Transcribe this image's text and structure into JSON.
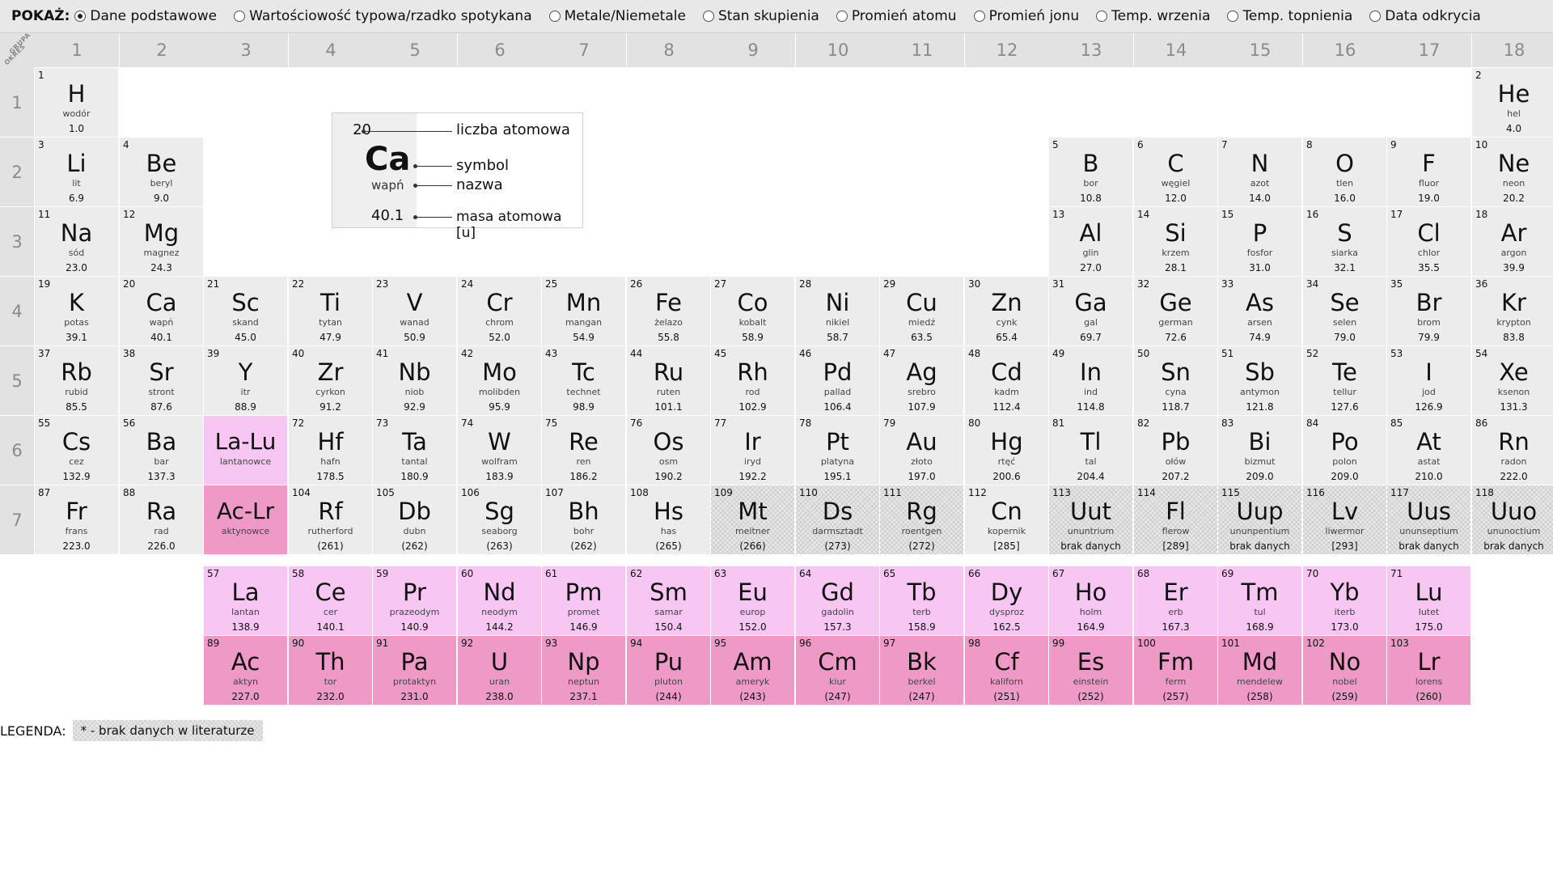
{
  "show_label": "POKAŻ:",
  "options": [
    {
      "label": "Dane podstawowe",
      "checked": true
    },
    {
      "label": "Wartościowość typowa/rzadko spotykana",
      "checked": false
    },
    {
      "label": "Metale/Niemetale",
      "checked": false
    },
    {
      "label": "Stan skupienia",
      "checked": false
    },
    {
      "label": "Promień atomu",
      "checked": false
    },
    {
      "label": "Promień jonu",
      "checked": false
    },
    {
      "label": "Temp. wrzenia",
      "checked": false
    },
    {
      "label": "Temp. topnienia",
      "checked": false
    },
    {
      "label": "Data odkrycia",
      "checked": false
    }
  ],
  "corner": {
    "grupa": "GRUPA",
    "okres": "OKRES"
  },
  "groups": [
    "1",
    "2",
    "3",
    "4",
    "5",
    "6",
    "7",
    "8",
    "9",
    "10",
    "11",
    "12",
    "13",
    "14",
    "15",
    "16",
    "17",
    "18"
  ],
  "periods": [
    "1",
    "2",
    "3",
    "4",
    "5",
    "6",
    "7"
  ],
  "key": {
    "num": "20",
    "sym": "Ca",
    "name": "wapń",
    "mass": "40.1",
    "lbl_num": "liczba atomowa",
    "lbl_sym": "symbol",
    "lbl_name": "nazwa",
    "lbl_mass": "masa atomowa [u]"
  },
  "elements": [
    {
      "n": "1",
      "s": "H",
      "name": "wodór",
      "m": "1.0",
      "p": 1,
      "g": 1
    },
    {
      "n": "2",
      "s": "He",
      "name": "hel",
      "m": "4.0",
      "p": 1,
      "g": 18
    },
    {
      "n": "3",
      "s": "Li",
      "name": "lit",
      "m": "6.9",
      "p": 2,
      "g": 1
    },
    {
      "n": "4",
      "s": "Be",
      "name": "beryl",
      "m": "9.0",
      "p": 2,
      "g": 2
    },
    {
      "n": "5",
      "s": "B",
      "name": "bor",
      "m": "10.8",
      "p": 2,
      "g": 13
    },
    {
      "n": "6",
      "s": "C",
      "name": "węgiel",
      "m": "12.0",
      "p": 2,
      "g": 14
    },
    {
      "n": "7",
      "s": "N",
      "name": "azot",
      "m": "14.0",
      "p": 2,
      "g": 15
    },
    {
      "n": "8",
      "s": "O",
      "name": "tlen",
      "m": "16.0",
      "p": 2,
      "g": 16
    },
    {
      "n": "9",
      "s": "F",
      "name": "fluor",
      "m": "19.0",
      "p": 2,
      "g": 17
    },
    {
      "n": "10",
      "s": "Ne",
      "name": "neon",
      "m": "20.2",
      "p": 2,
      "g": 18
    },
    {
      "n": "11",
      "s": "Na",
      "name": "sód",
      "m": "23.0",
      "p": 3,
      "g": 1
    },
    {
      "n": "12",
      "s": "Mg",
      "name": "magnez",
      "m": "24.3",
      "p": 3,
      "g": 2
    },
    {
      "n": "13",
      "s": "Al",
      "name": "glin",
      "m": "27.0",
      "p": 3,
      "g": 13
    },
    {
      "n": "14",
      "s": "Si",
      "name": "krzem",
      "m": "28.1",
      "p": 3,
      "g": 14
    },
    {
      "n": "15",
      "s": "P",
      "name": "fosfor",
      "m": "31.0",
      "p": 3,
      "g": 15
    },
    {
      "n": "16",
      "s": "S",
      "name": "siarka",
      "m": "32.1",
      "p": 3,
      "g": 16
    },
    {
      "n": "17",
      "s": "Cl",
      "name": "chlor",
      "m": "35.5",
      "p": 3,
      "g": 17
    },
    {
      "n": "18",
      "s": "Ar",
      "name": "argon",
      "m": "39.9",
      "p": 3,
      "g": 18
    },
    {
      "n": "19",
      "s": "K",
      "name": "potas",
      "m": "39.1",
      "p": 4,
      "g": 1
    },
    {
      "n": "20",
      "s": "Ca",
      "name": "wapń",
      "m": "40.1",
      "p": 4,
      "g": 2
    },
    {
      "n": "21",
      "s": "Sc",
      "name": "skand",
      "m": "45.0",
      "p": 4,
      "g": 3
    },
    {
      "n": "22",
      "s": "Ti",
      "name": "tytan",
      "m": "47.9",
      "p": 4,
      "g": 4
    },
    {
      "n": "23",
      "s": "V",
      "name": "wanad",
      "m": "50.9",
      "p": 4,
      "g": 5
    },
    {
      "n": "24",
      "s": "Cr",
      "name": "chrom",
      "m": "52.0",
      "p": 4,
      "g": 6
    },
    {
      "n": "25",
      "s": "Mn",
      "name": "mangan",
      "m": "54.9",
      "p": 4,
      "g": 7
    },
    {
      "n": "26",
      "s": "Fe",
      "name": "żelazo",
      "m": "55.8",
      "p": 4,
      "g": 8
    },
    {
      "n": "27",
      "s": "Co",
      "name": "kobalt",
      "m": "58.9",
      "p": 4,
      "g": 9
    },
    {
      "n": "28",
      "s": "Ni",
      "name": "nikiel",
      "m": "58.7",
      "p": 4,
      "g": 10
    },
    {
      "n": "29",
      "s": "Cu",
      "name": "miedź",
      "m": "63.5",
      "p": 4,
      "g": 11
    },
    {
      "n": "30",
      "s": "Zn",
      "name": "cynk",
      "m": "65.4",
      "p": 4,
      "g": 12
    },
    {
      "n": "31",
      "s": "Ga",
      "name": "gal",
      "m": "69.7",
      "p": 4,
      "g": 13
    },
    {
      "n": "32",
      "s": "Ge",
      "name": "german",
      "m": "72.6",
      "p": 4,
      "g": 14
    },
    {
      "n": "33",
      "s": "As",
      "name": "arsen",
      "m": "74.9",
      "p": 4,
      "g": 15
    },
    {
      "n": "34",
      "s": "Se",
      "name": "selen",
      "m": "79.0",
      "p": 4,
      "g": 16
    },
    {
      "n": "35",
      "s": "Br",
      "name": "brom",
      "m": "79.9",
      "p": 4,
      "g": 17
    },
    {
      "n": "36",
      "s": "Kr",
      "name": "krypton",
      "m": "83.8",
      "p": 4,
      "g": 18
    },
    {
      "n": "37",
      "s": "Rb",
      "name": "rubid",
      "m": "85.5",
      "p": 5,
      "g": 1
    },
    {
      "n": "38",
      "s": "Sr",
      "name": "stront",
      "m": "87.6",
      "p": 5,
      "g": 2
    },
    {
      "n": "39",
      "s": "Y",
      "name": "itr",
      "m": "88.9",
      "p": 5,
      "g": 3
    },
    {
      "n": "40",
      "s": "Zr",
      "name": "cyrkon",
      "m": "91.2",
      "p": 5,
      "g": 4
    },
    {
      "n": "41",
      "s": "Nb",
      "name": "niob",
      "m": "92.9",
      "p": 5,
      "g": 5
    },
    {
      "n": "42",
      "s": "Mo",
      "name": "molibden",
      "m": "95.9",
      "p": 5,
      "g": 6
    },
    {
      "n": "43",
      "s": "Tc",
      "name": "technet",
      "m": "98.9",
      "p": 5,
      "g": 7
    },
    {
      "n": "44",
      "s": "Ru",
      "name": "ruten",
      "m": "101.1",
      "p": 5,
      "g": 8
    },
    {
      "n": "45",
      "s": "Rh",
      "name": "rod",
      "m": "102.9",
      "p": 5,
      "g": 9
    },
    {
      "n": "46",
      "s": "Pd",
      "name": "pallad",
      "m": "106.4",
      "p": 5,
      "g": 10
    },
    {
      "n": "47",
      "s": "Ag",
      "name": "srebro",
      "m": "107.9",
      "p": 5,
      "g": 11
    },
    {
      "n": "48",
      "s": "Cd",
      "name": "kadm",
      "m": "112.4",
      "p": 5,
      "g": 12
    },
    {
      "n": "49",
      "s": "In",
      "name": "ind",
      "m": "114.8",
      "p": 5,
      "g": 13
    },
    {
      "n": "50",
      "s": "Sn",
      "name": "cyna",
      "m": "118.7",
      "p": 5,
      "g": 14
    },
    {
      "n": "51",
      "s": "Sb",
      "name": "antymon",
      "m": "121.8",
      "p": 5,
      "g": 15
    },
    {
      "n": "52",
      "s": "Te",
      "name": "tellur",
      "m": "127.6",
      "p": 5,
      "g": 16
    },
    {
      "n": "53",
      "s": "I",
      "name": "jod",
      "m": "126.9",
      "p": 5,
      "g": 17
    },
    {
      "n": "54",
      "s": "Xe",
      "name": "ksenon",
      "m": "131.3",
      "p": 5,
      "g": 18
    },
    {
      "n": "55",
      "s": "Cs",
      "name": "cez",
      "m": "132.9",
      "p": 6,
      "g": 1
    },
    {
      "n": "56",
      "s": "Ba",
      "name": "bar",
      "m": "137.3",
      "p": 6,
      "g": 2
    },
    {
      "n": "",
      "s": "La-Lu",
      "name": "lantanowce",
      "m": "",
      "p": 6,
      "g": 3,
      "cls": "la-placeholder placeholder"
    },
    {
      "n": "72",
      "s": "Hf",
      "name": "hafn",
      "m": "178.5",
      "p": 6,
      "g": 4
    },
    {
      "n": "73",
      "s": "Ta",
      "name": "tantal",
      "m": "180.9",
      "p": 6,
      "g": 5
    },
    {
      "n": "74",
      "s": "W",
      "name": "wolfram",
      "m": "183.9",
      "p": 6,
      "g": 6
    },
    {
      "n": "75",
      "s": "Re",
      "name": "ren",
      "m": "186.2",
      "p": 6,
      "g": 7
    },
    {
      "n": "76",
      "s": "Os",
      "name": "osm",
      "m": "190.2",
      "p": 6,
      "g": 8
    },
    {
      "n": "77",
      "s": "Ir",
      "name": "iryd",
      "m": "192.2",
      "p": 6,
      "g": 9
    },
    {
      "n": "78",
      "s": "Pt",
      "name": "platyna",
      "m": "195.1",
      "p": 6,
      "g": 10
    },
    {
      "n": "79",
      "s": "Au",
      "name": "złoto",
      "m": "197.0",
      "p": 6,
      "g": 11
    },
    {
      "n": "80",
      "s": "Hg",
      "name": "rtęć",
      "m": "200.6",
      "p": 6,
      "g": 12
    },
    {
      "n": "81",
      "s": "Tl",
      "name": "tal",
      "m": "204.4",
      "p": 6,
      "g": 13
    },
    {
      "n": "82",
      "s": "Pb",
      "name": "ołów",
      "m": "207.2",
      "p": 6,
      "g": 14
    },
    {
      "n": "83",
      "s": "Bi",
      "name": "bizmut",
      "m": "209.0",
      "p": 6,
      "g": 15
    },
    {
      "n": "84",
      "s": "Po",
      "name": "polon",
      "m": "209.0",
      "p": 6,
      "g": 16
    },
    {
      "n": "85",
      "s": "At",
      "name": "astat",
      "m": "210.0",
      "p": 6,
      "g": 17
    },
    {
      "n": "86",
      "s": "Rn",
      "name": "radon",
      "m": "222.0",
      "p": 6,
      "g": 18
    },
    {
      "n": "87",
      "s": "Fr",
      "name": "frans",
      "m": "223.0",
      "p": 7,
      "g": 1
    },
    {
      "n": "88",
      "s": "Ra",
      "name": "rad",
      "m": "226.0",
      "p": 7,
      "g": 2
    },
    {
      "n": "",
      "s": "Ac-Lr",
      "name": "aktynowce",
      "m": "",
      "p": 7,
      "g": 3,
      "cls": "ac-placeholder placeholder"
    },
    {
      "n": "104",
      "s": "Rf",
      "name": "rutherford",
      "m": "(261)",
      "p": 7,
      "g": 4
    },
    {
      "n": "105",
      "s": "Db",
      "name": "dubn",
      "m": "(262)",
      "p": 7,
      "g": 5
    },
    {
      "n": "106",
      "s": "Sg",
      "name": "seaborg",
      "m": "(263)",
      "p": 7,
      "g": 6
    },
    {
      "n": "107",
      "s": "Bh",
      "name": "bohr",
      "m": "(262)",
      "p": 7,
      "g": 7
    },
    {
      "n": "108",
      "s": "Hs",
      "name": "has",
      "m": "(265)",
      "p": 7,
      "g": 8
    },
    {
      "n": "109",
      "s": "Mt",
      "name": "meitner",
      "m": "(266)",
      "p": 7,
      "g": 9,
      "cls": "hatch"
    },
    {
      "n": "110",
      "s": "Ds",
      "name": "darmsztadt",
      "m": "(273)",
      "p": 7,
      "g": 10,
      "cls": "hatch"
    },
    {
      "n": "111",
      "s": "Rg",
      "name": "roentgen",
      "m": "(272)",
      "p": 7,
      "g": 11,
      "cls": "hatch"
    },
    {
      "n": "112",
      "s": "Cn",
      "name": "kopernik",
      "m": "[285]",
      "p": 7,
      "g": 12
    },
    {
      "n": "113",
      "s": "Uut",
      "name": "ununtrium",
      "m": "brak danych",
      "p": 7,
      "g": 13,
      "cls": "hatch"
    },
    {
      "n": "114",
      "s": "Fl",
      "name": "flerow",
      "m": "[289]",
      "p": 7,
      "g": 14,
      "cls": "hatch"
    },
    {
      "n": "115",
      "s": "Uup",
      "name": "ununpentium",
      "m": "brak danych",
      "p": 7,
      "g": 15,
      "cls": "hatch"
    },
    {
      "n": "116",
      "s": "Lv",
      "name": "liwermor",
      "m": "[293]",
      "p": 7,
      "g": 16,
      "cls": "hatch"
    },
    {
      "n": "117",
      "s": "Uus",
      "name": "ununseptium",
      "m": "brak danych",
      "p": 7,
      "g": 17,
      "cls": "hatch"
    },
    {
      "n": "118",
      "s": "Uuo",
      "name": "ununoctium",
      "m": "brak danych",
      "p": 7,
      "g": 18,
      "cls": "hatch"
    },
    {
      "n": "57",
      "s": "La",
      "name": "lantan",
      "m": "138.9",
      "p": 8,
      "g": 3,
      "cls": "lanthanide"
    },
    {
      "n": "58",
      "s": "Ce",
      "name": "cer",
      "m": "140.1",
      "p": 8,
      "g": 4,
      "cls": "lanthanide"
    },
    {
      "n": "59",
      "s": "Pr",
      "name": "prazeodym",
      "m": "140.9",
      "p": 8,
      "g": 5,
      "cls": "lanthanide"
    },
    {
      "n": "60",
      "s": "Nd",
      "name": "neodym",
      "m": "144.2",
      "p": 8,
      "g": 6,
      "cls": "lanthanide"
    },
    {
      "n": "61",
      "s": "Pm",
      "name": "promet",
      "m": "146.9",
      "p": 8,
      "g": 7,
      "cls": "lanthanide"
    },
    {
      "n": "62",
      "s": "Sm",
      "name": "samar",
      "m": "150.4",
      "p": 8,
      "g": 8,
      "cls": "lanthanide"
    },
    {
      "n": "63",
      "s": "Eu",
      "name": "europ",
      "m": "152.0",
      "p": 8,
      "g": 9,
      "cls": "lanthanide"
    },
    {
      "n": "64",
      "s": "Gd",
      "name": "gadolin",
      "m": "157.3",
      "p": 8,
      "g": 10,
      "cls": "lanthanide"
    },
    {
      "n": "65",
      "s": "Tb",
      "name": "terb",
      "m": "158.9",
      "p": 8,
      "g": 11,
      "cls": "lanthanide"
    },
    {
      "n": "66",
      "s": "Dy",
      "name": "dysproz",
      "m": "162.5",
      "p": 8,
      "g": 12,
      "cls": "lanthanide"
    },
    {
      "n": "67",
      "s": "Ho",
      "name": "holm",
      "m": "164.9",
      "p": 8,
      "g": 13,
      "cls": "lanthanide"
    },
    {
      "n": "68",
      "s": "Er",
      "name": "erb",
      "m": "167.3",
      "p": 8,
      "g": 14,
      "cls": "lanthanide"
    },
    {
      "n": "69",
      "s": "Tm",
      "name": "tul",
      "m": "168.9",
      "p": 8,
      "g": 15,
      "cls": "lanthanide"
    },
    {
      "n": "70",
      "s": "Yb",
      "name": "iterb",
      "m": "173.0",
      "p": 8,
      "g": 16,
      "cls": "lanthanide"
    },
    {
      "n": "71",
      "s": "Lu",
      "name": "lutet",
      "m": "175.0",
      "p": 8,
      "g": 17,
      "cls": "lanthanide"
    },
    {
      "n": "89",
      "s": "Ac",
      "name": "aktyn",
      "m": "227.0",
      "p": 9,
      "g": 3,
      "cls": "actinide"
    },
    {
      "n": "90",
      "s": "Th",
      "name": "tor",
      "m": "232.0",
      "p": 9,
      "g": 4,
      "cls": "actinide"
    },
    {
      "n": "91",
      "s": "Pa",
      "name": "protaktyn",
      "m": "231.0",
      "p": 9,
      "g": 5,
      "cls": "actinide"
    },
    {
      "n": "92",
      "s": "U",
      "name": "uran",
      "m": "238.0",
      "p": 9,
      "g": 6,
      "cls": "actinide"
    },
    {
      "n": "93",
      "s": "Np",
      "name": "neptun",
      "m": "237.1",
      "p": 9,
      "g": 7,
      "cls": "actinide"
    },
    {
      "n": "94",
      "s": "Pu",
      "name": "pluton",
      "m": "(244)",
      "p": 9,
      "g": 8,
      "cls": "actinide"
    },
    {
      "n": "95",
      "s": "Am",
      "name": "ameryk",
      "m": "(243)",
      "p": 9,
      "g": 9,
      "cls": "actinide"
    },
    {
      "n": "96",
      "s": "Cm",
      "name": "kiur",
      "m": "(247)",
      "p": 9,
      "g": 10,
      "cls": "actinide"
    },
    {
      "n": "97",
      "s": "Bk",
      "name": "berkel",
      "m": "(247)",
      "p": 9,
      "g": 11,
      "cls": "actinide"
    },
    {
      "n": "98",
      "s": "Cf",
      "name": "kaliforn",
      "m": "(251)",
      "p": 9,
      "g": 12,
      "cls": "actinide"
    },
    {
      "n": "99",
      "s": "Es",
      "name": "einstein",
      "m": "(252)",
      "p": 9,
      "g": 13,
      "cls": "actinide"
    },
    {
      "n": "100",
      "s": "Fm",
      "name": "ferm",
      "m": "(257)",
      "p": 9,
      "g": 14,
      "cls": "actinide"
    },
    {
      "n": "101",
      "s": "Md",
      "name": "mendelew",
      "m": "(258)",
      "p": 9,
      "g": 15,
      "cls": "actinide"
    },
    {
      "n": "102",
      "s": "No",
      "name": "nobel",
      "m": "(259)",
      "p": 9,
      "g": 16,
      "cls": "actinide"
    },
    {
      "n": "103",
      "s": "Lr",
      "name": "lorens",
      "m": "(260)",
      "p": 9,
      "g": 17,
      "cls": "actinide"
    }
  ],
  "legend": {
    "label": "LEGENDA:",
    "item": "* - brak danych w literaturze"
  }
}
